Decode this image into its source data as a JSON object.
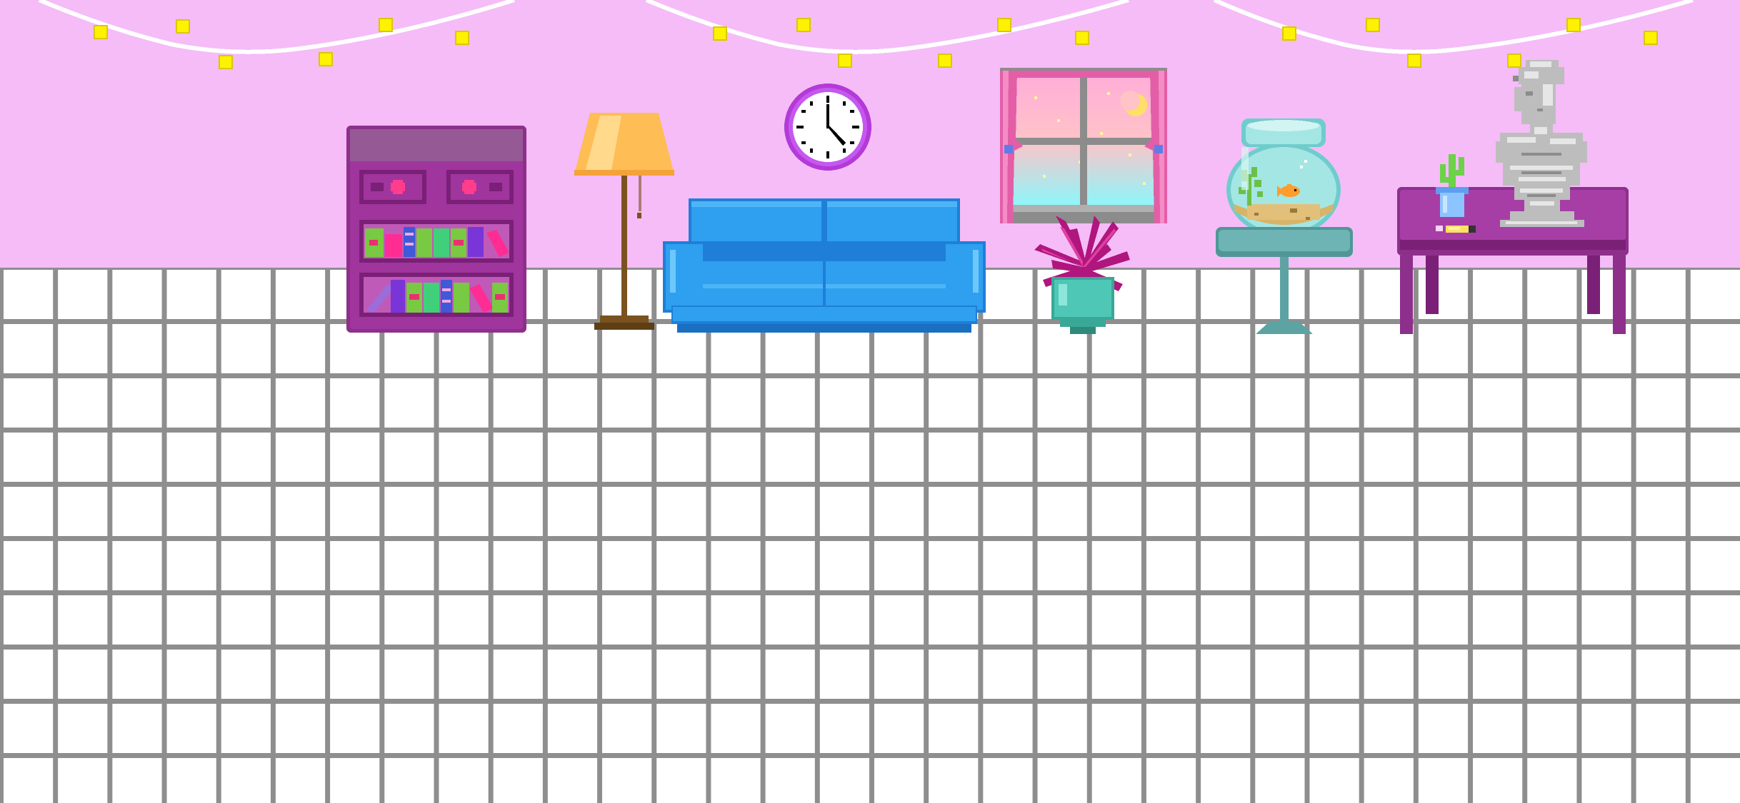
{
  "scene": {
    "colors": {
      "wall": "#f5bcf8",
      "floor": "#ffffff",
      "floor_grid": "#8e8e8e",
      "string_lights_bulb": "#fff200",
      "bookshelf": "#a0359d",
      "sofa": "#2f9ff0",
      "plant": "#b0167e",
      "plant_pot": "#4fc7b6",
      "lamp_shade": "#ffbd55",
      "clock_rim": "#c558ef",
      "table": "#a63ea6",
      "aquarium_glass": "#86d9d8",
      "side_table": "#6fb4b4",
      "bust": "#c9c9c9"
    },
    "objects": [
      {
        "name": "string-lights",
        "icon": "string-lights-icon"
      },
      {
        "name": "bookshelf",
        "icon": "bookshelf-icon"
      },
      {
        "name": "floor-lamp",
        "icon": "floor-lamp-icon"
      },
      {
        "name": "wall-clock",
        "icon": "clock-icon"
      },
      {
        "name": "sofa",
        "icon": "sofa-icon"
      },
      {
        "name": "window",
        "icon": "window-icon"
      },
      {
        "name": "potted-plant",
        "icon": "plant-icon"
      },
      {
        "name": "fish-bowl",
        "icon": "fishbowl-icon"
      },
      {
        "name": "side-table",
        "icon": "side-table-icon"
      },
      {
        "name": "desk-table",
        "icon": "table-icon"
      },
      {
        "name": "cactus-cup",
        "icon": "cactus-icon"
      },
      {
        "name": "bust-statue",
        "icon": "statue-icon"
      }
    ]
  }
}
